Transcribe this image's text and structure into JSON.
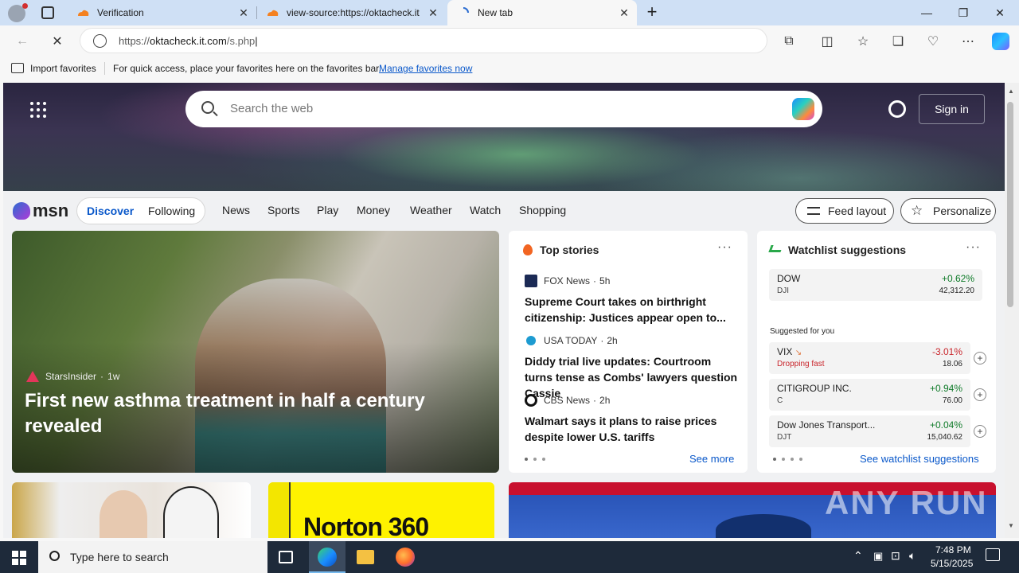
{
  "browser": {
    "tabs": [
      {
        "title": "Verification",
        "active": false
      },
      {
        "title": "view-source:https://oktacheck.it",
        "active": false
      },
      {
        "title": "New tab",
        "active": true
      }
    ],
    "url": {
      "scheme": "https://",
      "host": "oktacheck.it.com",
      "path": "/s.php"
    },
    "favorites_bar": {
      "import_label": "Import favorites",
      "hint": "For quick access, place your favorites here on the favorites bar.",
      "manage_link": "Manage favorites now"
    }
  },
  "newtab": {
    "search_placeholder": "Search the web",
    "sign_in": "Sign in",
    "brand": "msn",
    "tabs": [
      "Discover",
      "Following"
    ],
    "nav": [
      "News",
      "Sports",
      "Play",
      "Money",
      "Weather",
      "Watch",
      "Shopping"
    ],
    "feed_layout": "Feed layout",
    "personalize": "Personalize"
  },
  "hero_story": {
    "source": "StarsInsider",
    "age": "1w",
    "headline": "First new asthma treatment in half a century revealed"
  },
  "top_stories": {
    "title": "Top stories",
    "items": [
      {
        "source": "FOX News",
        "age": "5h",
        "headline": "Supreme Court takes on birthright citizenship: Justices appear open to..."
      },
      {
        "source": "USA TODAY",
        "age": "2h",
        "headline": "Diddy trial live updates: Courtroom turns tense as Combs' lawyers question Cassie"
      },
      {
        "source": "CBS News",
        "age": "2h",
        "headline": "Walmart says it plans to raise prices despite lower U.S. tariffs"
      }
    ],
    "see_more": "See more"
  },
  "watchlist": {
    "title": "Watchlist suggestions",
    "dow": {
      "name": "DOW",
      "symbol": "DJI",
      "change": "+0.62%",
      "value": "42,312.20"
    },
    "suggested_label": "Suggested for you",
    "items": [
      {
        "name": "VIX",
        "note": "Dropping fast",
        "change": "-3.01%",
        "value": "18.06",
        "dir": "down"
      },
      {
        "name": "CITIGROUP INC.",
        "symbol": "C",
        "change": "+0.94%",
        "value": "76.00",
        "dir": "up"
      },
      {
        "name": "Dow Jones Transport...",
        "symbol": "DJT",
        "change": "+0.04%",
        "value": "15,040.62",
        "dir": "up"
      }
    ],
    "see_link": "See watchlist suggestions"
  },
  "promo": {
    "text": "Norton 360"
  },
  "taskbar": {
    "search_placeholder": "Type here to search",
    "time": "7:48 PM",
    "date": "5/15/2025"
  },
  "watermark": "ANY RUN",
  "colors": {
    "accent": "#0a58ca",
    "up": "#0e7a28",
    "down": "#c9252b"
  }
}
